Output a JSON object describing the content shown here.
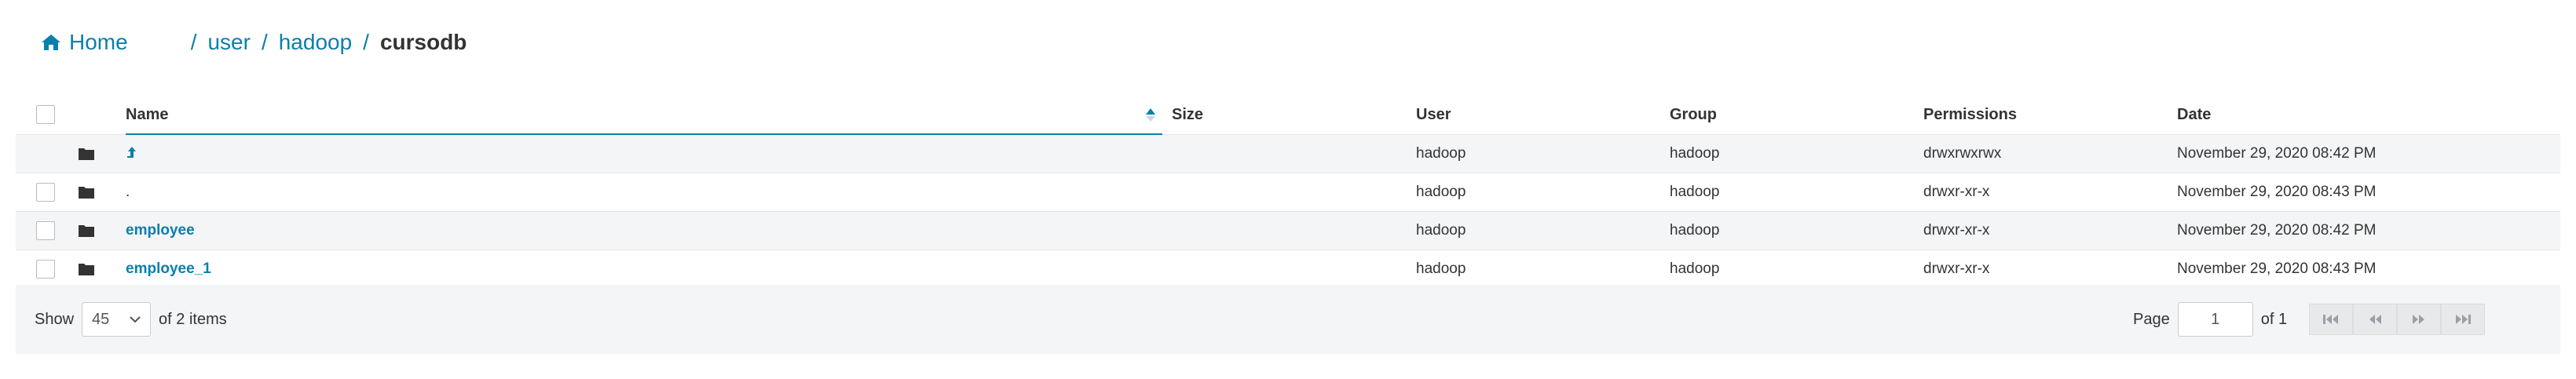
{
  "breadcrumb": {
    "home_label": "Home",
    "segments": [
      "user",
      "hadoop",
      "cursodb"
    ],
    "separator": "/"
  },
  "table": {
    "columns": [
      "Name",
      "Size",
      "User",
      "Group",
      "Permissions",
      "Date"
    ],
    "rows": [
      {
        "name": "",
        "size": "",
        "user": "hadoop",
        "group": "hadoop",
        "permissions": "drwxrwxrwx",
        "date": "November 29, 2020 08:42 PM"
      },
      {
        "name": ".",
        "size": "",
        "user": "hadoop",
        "group": "hadoop",
        "permissions": "drwxr-xr-x",
        "date": "November 29, 2020 08:43 PM"
      },
      {
        "name": "employee",
        "size": "",
        "user": "hadoop",
        "group": "hadoop",
        "permissions": "drwxr-xr-x",
        "date": "November 29, 2020 08:42 PM"
      },
      {
        "name": "employee_1",
        "size": "",
        "user": "hadoop",
        "group": "hadoop",
        "permissions": "drwxr-xr-x",
        "date": "November 29, 2020 08:43 PM"
      }
    ]
  },
  "footer": {
    "show_label": "Show",
    "page_size": "45",
    "items_text": "of 2 items",
    "page_label": "Page",
    "page_value": "1",
    "of_pages": "of 1"
  },
  "colors": {
    "link": "#0b7fad",
    "row_alt": "#f4f5f6"
  },
  "icons": [
    "home-icon",
    "folder-icon",
    "up-arrow-icon",
    "sort-asc-icon",
    "first-page-icon",
    "prev-page-icon",
    "next-page-icon",
    "last-page-icon"
  ]
}
